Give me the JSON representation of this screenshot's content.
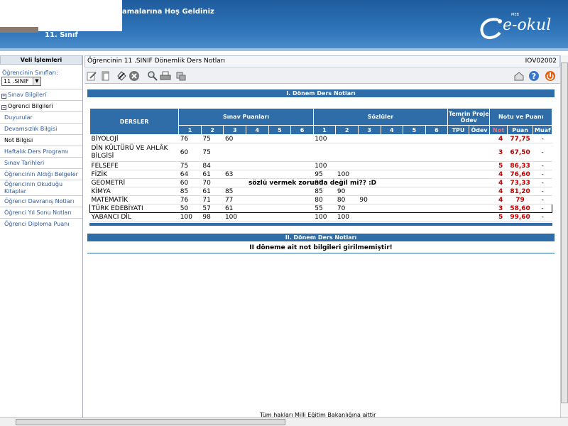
{
  "header": {
    "welcome": "amalarına Hoş Geldiniz",
    "grade": "11. Sınıf",
    "logo_small": "MEB",
    "logo_main": "e-okul"
  },
  "sidebar": {
    "title": "Veli İşlemleri",
    "class_label": "Öğrencinin Sınıfları:",
    "class_value": "11 .SINIF",
    "items": [
      {
        "label": "Sınav Bilgileri",
        "expander": "+"
      },
      {
        "label": "Ogrenci Bilgileri",
        "expander": "−"
      },
      {
        "label": "Duyurular"
      },
      {
        "label": "Devamsızlık Bilgisi"
      },
      {
        "label": "Not Bilgisi"
      },
      {
        "label": "Haftalık Ders Programı"
      },
      {
        "label": "Sınav Tarihleri"
      },
      {
        "label": "Öğrencinin Aldığı Belgeler"
      },
      {
        "label": "Öğrencinin Okuduğu Kitaplar"
      },
      {
        "label": "Öğrenci Davranış Notları"
      },
      {
        "label": "Öğrenci Yıl Sonu Notları"
      },
      {
        "label": "Öğrenci Diploma Puanı"
      }
    ]
  },
  "main": {
    "title": "Öğrencinin  11 .SINIF  Dönemlik Ders Notları",
    "code": "IOV02002"
  },
  "term1": {
    "heading": "I. Dönem Ders Notları",
    "col_dersler": "DERSLER",
    "col_sinav": "Sınav Puanları",
    "col_sozlu": "Sözlüler",
    "col_temrin": "Temrin Proje Ödev",
    "col_notu": "Notu ve Puanı",
    "sub_numbers": [
      "1",
      "2",
      "3",
      "4",
      "5",
      "6"
    ],
    "sub_tpu": "TPU",
    "sub_odev": "Ödev",
    "sub_not": "Not",
    "sub_puan": "Puan",
    "sub_muaf": "Muaf",
    "rows": [
      {
        "ders": "BİYOLOJİ",
        "sinav": [
          "76",
          "75",
          "60",
          "",
          "",
          ""
        ],
        "sozlu": [
          "100",
          "",
          "",
          "",
          "",
          ""
        ],
        "tpu": "",
        "odev": "",
        "not": "4",
        "puan": "77,75",
        "muaf": "-"
      },
      {
        "ders": "DİN KÜLTÜRÜ VE AHLÂK BİLGİSİ",
        "sinav": [
          "60",
          "75",
          "",
          "",
          "",
          ""
        ],
        "sozlu": [
          "",
          "",
          "",
          "",
          "",
          ""
        ],
        "tpu": "",
        "odev": "",
        "not": "3",
        "puan": "67,50",
        "muaf": "-"
      },
      {
        "ders": "FELSEFE",
        "sinav": [
          "75",
          "84",
          "",
          "",
          "",
          ""
        ],
        "sozlu": [
          "100",
          "",
          "",
          "",
          "",
          ""
        ],
        "tpu": "",
        "odev": "",
        "not": "5",
        "puan": "86,33",
        "muaf": "-"
      },
      {
        "ders": "FİZİK",
        "sinav": [
          "64",
          "61",
          "63",
          "",
          "",
          ""
        ],
        "sozlu": [
          "95",
          "100",
          "",
          "",
          "",
          ""
        ],
        "tpu": "",
        "odev": "",
        "not": "4",
        "puan": "76,60",
        "muaf": "-"
      },
      {
        "ders": "GEOMETRİ",
        "sinav": [
          "60",
          "70",
          "",
          "",
          "",
          ""
        ],
        "sozlu": [
          "90",
          "",
          "",
          "",
          "",
          ""
        ],
        "tpu": "",
        "odev": "",
        "not": "4",
        "puan": "73,33",
        "muaf": "-"
      },
      {
        "ders": "KİMYA",
        "sinav": [
          "85",
          "61",
          "85",
          "",
          "",
          ""
        ],
        "sozlu": [
          "85",
          "90",
          "",
          "",
          "",
          ""
        ],
        "tpu": "",
        "odev": "",
        "not": "4",
        "puan": "81,20",
        "muaf": "-"
      },
      {
        "ders": "MATEMATİK",
        "sinav": [
          "76",
          "71",
          "77",
          "",
          "",
          ""
        ],
        "sozlu": [
          "80",
          "80",
          "90",
          "",
          "",
          ""
        ],
        "tpu": "",
        "odev": "",
        "not": "4",
        "puan": "79",
        "muaf": "-"
      },
      {
        "ders": "TÜRK EDEBİYATI",
        "sinav": [
          "50",
          "57",
          "61",
          "",
          "",
          ""
        ],
        "sozlu": [
          "55",
          "70",
          "",
          "",
          "",
          ""
        ],
        "tpu": "",
        "odev": "",
        "not": "3",
        "puan": "58,60",
        "muaf": "-"
      },
      {
        "ders": "YABANCI DİL",
        "sinav": [
          "100",
          "98",
          "100",
          "",
          "",
          ""
        ],
        "sozlu": [
          "100",
          "100",
          "",
          "",
          "",
          ""
        ],
        "tpu": "",
        "odev": "",
        "not": "5",
        "puan": "99,60",
        "muaf": "-"
      }
    ],
    "comment": "sözlü vermek zorunda değil mi?? :D"
  },
  "term2": {
    "heading": "II. Dönem Ders Notları",
    "message": "II döneme ait not bilgileri girilmemiştir!"
  },
  "footer": "Tüm hakları Milli Eğitim Bakanlığına aittir",
  "colors": {
    "header_blue": "#2e6da7",
    "grade_red": "#c00000"
  }
}
